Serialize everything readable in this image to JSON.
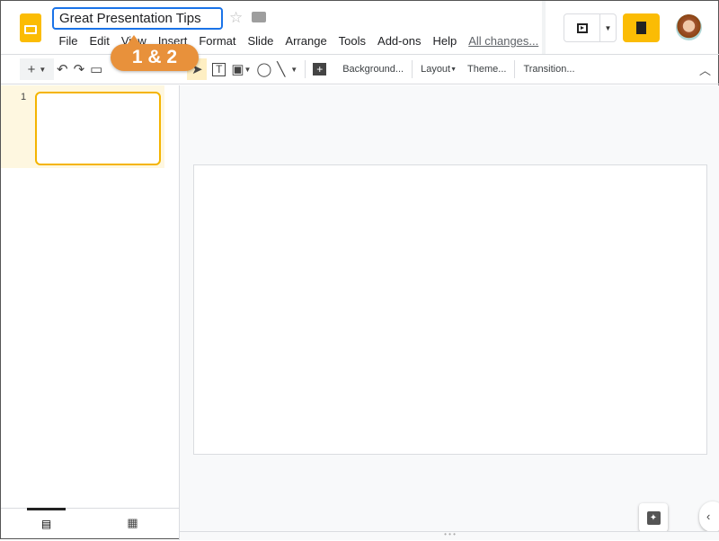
{
  "title": "Great Presentation Tips",
  "menu": [
    "File",
    "Edit",
    "View",
    "Insert",
    "Format",
    "Slide",
    "Arrange",
    "Tools",
    "Add-ons",
    "Help"
  ],
  "save_status": "All changes...",
  "toolbar": {
    "background": "Background...",
    "layout": "Layout",
    "theme": "Theme...",
    "transition": "Transition..."
  },
  "callout": "1 & 2",
  "slides": [
    {
      "number": "1"
    }
  ],
  "colors": {
    "accent": "#1a73e8",
    "slides_brand": "#fbbc04",
    "callout": "#e8913b",
    "selected_slide": "#fef7e0"
  }
}
